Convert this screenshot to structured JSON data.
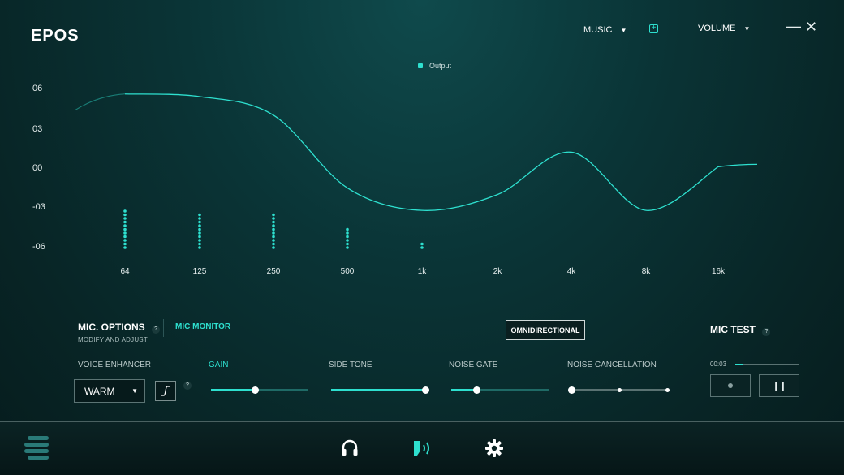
{
  "app": {
    "logo": "EPOS"
  },
  "header": {
    "preset_dropdown": "MUSIC",
    "output_dropdown": "VOLUME",
    "minimize": "—",
    "close": "✕"
  },
  "equalizer": {
    "legend_label": "Output",
    "y_ticks": [
      "06",
      "03",
      "00",
      "-03",
      "-06"
    ],
    "x_ticks": [
      "64",
      "125",
      "250",
      "500",
      "1k",
      "2k",
      "4k",
      "8k",
      "16k"
    ],
    "accent_color": "#2ee0cf"
  },
  "chart_data": {
    "type": "line",
    "series": [
      {
        "name": "Output",
        "x": [
          "64",
          "125",
          "250",
          "500",
          "1k",
          "2k",
          "4k",
          "8k",
          "16k"
        ],
        "values": [
          5.6,
          5.4,
          4.0,
          -1.5,
          -3.2,
          -2.0,
          1.2,
          -3.2,
          0.1
        ]
      }
    ],
    "ylim": [
      -7,
      7
    ],
    "level_bars": [
      {
        "band": "64",
        "level": 11
      },
      {
        "band": "125",
        "level": 10
      },
      {
        "band": "250",
        "level": 10
      },
      {
        "band": "500",
        "level": 6
      },
      {
        "band": "1k",
        "level": 2
      },
      {
        "band": "2k",
        "level": 0
      },
      {
        "band": "4k",
        "level": 0
      },
      {
        "band": "8k",
        "level": 0
      },
      {
        "band": "16k",
        "level": 0
      }
    ]
  },
  "mic": {
    "options_title": "MIC. OPTIONS",
    "options_sub": "MODIFY AND ADJUST",
    "help": "?",
    "monitor": "MIC MONITOR",
    "pattern": "OMNIDIRECTIONAL",
    "voice_enhancer_label": "VOICE ENHANCER",
    "voice_enhancer_value": "WARM",
    "gain_label": "GAIN",
    "gain_value": 0.45,
    "side_tone_label": "SIDE TONE",
    "side_tone_value": 1.0,
    "noise_gate_label": "NOISE GATE",
    "noise_gate_value": 0.26,
    "noise_cancel_label": "NOISE CANCELLATION",
    "noise_cancel_level": 0
  },
  "mic_test": {
    "title": "MIC TEST",
    "time": "00:03",
    "progress": 0.11
  }
}
